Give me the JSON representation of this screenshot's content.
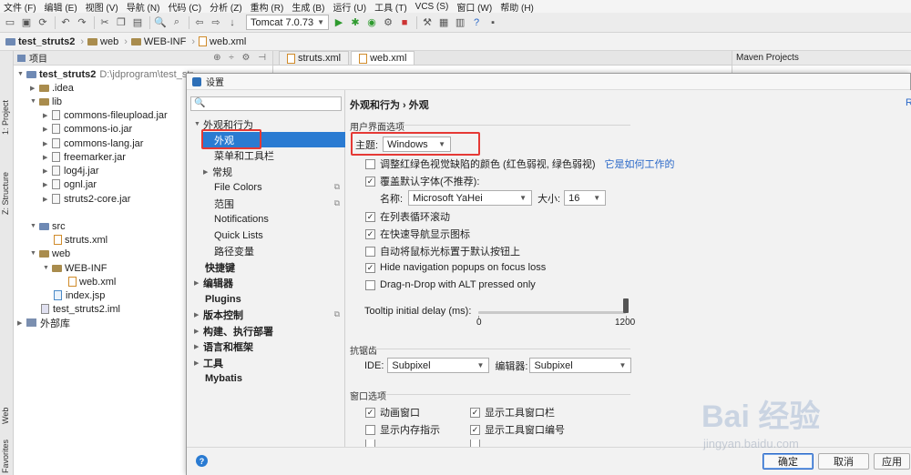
{
  "menu": [
    "文件 (F)",
    "编辑 (E)",
    "视图 (V)",
    "导航 (N)",
    "代码 (C)",
    "分析 (Z)",
    "重构 (R)",
    "生成 (B)",
    "运行 (U)",
    "工具 (T)",
    "VCS (S)",
    "窗口 (W)",
    "帮助 (H)"
  ],
  "toolbar": {
    "run_config": "Tomcat 7.0.73"
  },
  "breadcrumb": [
    "test_struts2",
    "web",
    "WEB-INF",
    "web.xml"
  ],
  "side_tabs": {
    "project": "1: Project",
    "structure": "Z: Structure",
    "web": "Web",
    "favorites": "Favorites"
  },
  "project": {
    "header": "项目",
    "root_name": "test_struts2",
    "root_path": "D:\\jdprogram\\test_str...",
    "nodes": [
      ".idea",
      "lib",
      "commons-fileupload.jar",
      "commons-io.jar",
      "commons-lang.jar",
      "freemarker.jar",
      "log4j.jar",
      "ognl.jar",
      "struts2-core.jar",
      "src",
      "struts.xml",
      "web",
      "WEB-INF",
      "web.xml",
      "index.jsp",
      "test_struts2.iml",
      "外部库"
    ]
  },
  "editor": {
    "tabs": [
      "struts.xml",
      "web.xml"
    ]
  },
  "maven": {
    "title": "Maven Projects"
  },
  "settings": {
    "title": "设置",
    "categories": {
      "appearance_behavior": "外观和行为",
      "appearance": "外观",
      "menus_toolbars": "菜单和工具栏",
      "system": "常规",
      "file_colors": "File Colors",
      "scopes": "范围",
      "notifications": "Notifications",
      "quick_lists": "Quick Lists",
      "path_vars": "路径变量",
      "keymap": "快捷键",
      "editor": "编辑器",
      "plugins": "Plugins",
      "vcs": "版本控制",
      "build": "构建、执行部署",
      "languages": "语言和框架",
      "tools": "工具",
      "mybatis": "Mybatis"
    },
    "breadcrumb": "外观和行为 › 外观",
    "reset_link": "R",
    "ui_options": "用户界面选项",
    "theme_label": "主题:",
    "theme_value": "Windows",
    "color_adjust": "调整红绿色视觉缺陷的颜色 (红色弱视, 绿色弱视)",
    "how_it_works": "它是如何工作的",
    "override_fonts": "覆盖默认字体(不推荐):",
    "font_name_label": "名称:",
    "font_name": "Microsoft YaHei",
    "font_size_label": "大小:",
    "font_size": "16",
    "cyclic_scroll": "在列表循环滚动",
    "show_icons_quicknav": "在快速导航显示图标",
    "auto_mouse": "自动将鼠标光标置于默认按钮上",
    "hide_nav_popups": "Hide navigation popups on focus loss",
    "drag_drop_alt": "Drag-n-Drop with ALT pressed only",
    "tooltip_delay_label": "Tooltip initial delay (ms):",
    "tooltip_min": "0",
    "tooltip_max": "1200",
    "tooltip_value_fraction": 1.0,
    "antialiasing": "抗锯齿",
    "ide_label": "IDE:",
    "ide_value": "Subpixel",
    "editor_label": "编辑器:",
    "editor_value": "Subpixel",
    "window_options": "窗口选项",
    "animate_windows": "动画窗口",
    "show_tool_window_bars": "显示工具窗口栏",
    "show_memory": "显示内存指示",
    "show_tool_window_numbers": "显示工具窗口编号",
    "ok": "确定",
    "cancel": "取消",
    "apply": "应用"
  },
  "watermark": {
    "logo": "Bai 经验",
    "url": "jingyan.baidu.com"
  }
}
